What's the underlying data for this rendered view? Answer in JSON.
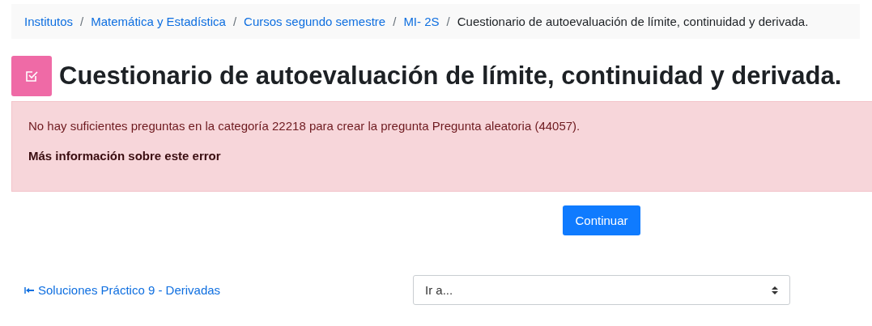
{
  "breadcrumb": [
    {
      "label": "Institutos",
      "link": true
    },
    {
      "separator": "/",
      "label": "Matemática y Estadística",
      "link": true
    },
    {
      "separator": "/",
      "label": "Cursos segundo semestre",
      "link": true
    },
    {
      "separator": "/",
      "label": "MI- 2S",
      "link": true
    },
    {
      "separator": "/",
      "label": "Cuestionario de autoevaluación de límite, continuidad y derivada.",
      "link": false
    }
  ],
  "page_title": "Cuestionario de autoevaluación de límite, continuidad y derivada.",
  "alert": {
    "message": "No hay suficientes preguntas en la categoría 22218 para crear la pregunta Pregunta aleatoria (44057).",
    "more_info": "Más información sobre este error"
  },
  "continue_button": "Continuar",
  "previous_link": "Soluciones Práctico 9 - Derivadas",
  "jump_select": {
    "value": "Ir a..."
  }
}
